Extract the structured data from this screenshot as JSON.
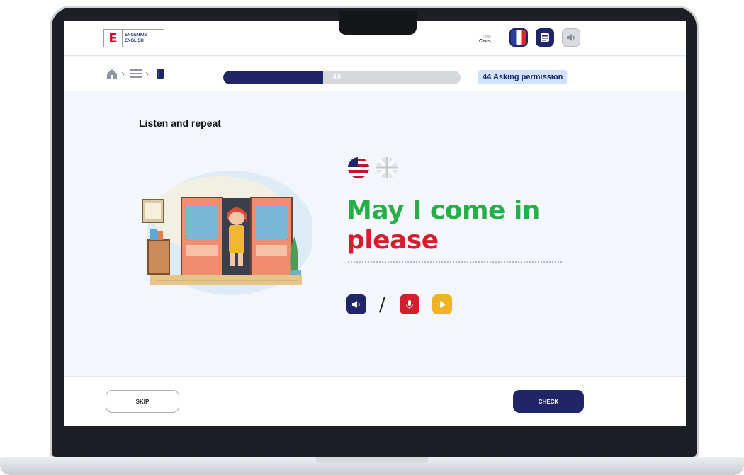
{
  "header": {
    "logo": {
      "mark": "E",
      "line1": "ENGENIUS",
      "line2": "ENGLISH"
    },
    "user": {
      "label": "Hello",
      "name": "Cecs"
    },
    "icons": [
      "flag-language-icon",
      "menu-book-icon",
      "speaker-icon"
    ]
  },
  "nav": {
    "breadcrumb_separator": "›",
    "progress": {
      "fraction": 0.42,
      "label": "4/6"
    },
    "lesson": "44 Asking permission"
  },
  "exercise": {
    "instruction": "Listen and repeat",
    "phrase_line1": "May I come in",
    "phrase_line2": "please",
    "separator": "/"
  },
  "footer": {
    "skip_label": "SKIP",
    "check_label": "CHECK"
  },
  "colors": {
    "primary": "#1f2566",
    "green": "#27ae48",
    "red": "#d21f2e",
    "yellow": "#f0b323",
    "badge_bg": "#cfe2ff"
  }
}
